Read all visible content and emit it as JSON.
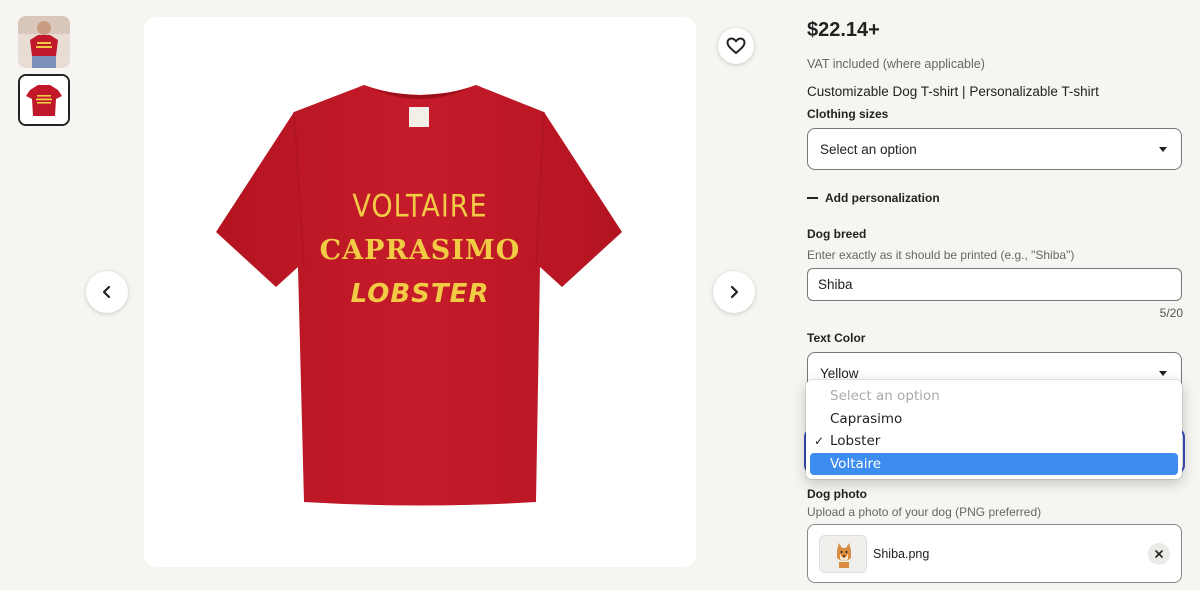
{
  "gallery": {
    "thumbnails": [
      "thumbnail-model-photo",
      "thumbnail-red-tshirt"
    ],
    "selected_index": 1,
    "shirt_color": "#c0182a",
    "print_color": "#f2cb45",
    "shirt_lines": [
      "VOLTAIRE",
      "CAPRASIMO",
      "LOBSTER"
    ]
  },
  "product": {
    "price": "$22.14+",
    "vat_note": "VAT included (where applicable)",
    "title": "Customizable Dog T-shirt | Personalizable T-shirt"
  },
  "sizes": {
    "label": "Clothing sizes",
    "value": "Select an option"
  },
  "personalization": {
    "toggle_label": "Add personalization"
  },
  "dog_breed": {
    "label": "Dog breed",
    "hint": "Enter exactly as it should be printed (e.g., \"Shiba\")",
    "value": "Shiba",
    "counter": "5/20"
  },
  "text_color": {
    "label": "Text Color",
    "value": "Yellow"
  },
  "font_dropdown": {
    "options": [
      {
        "label": "Select an option",
        "disabled": true
      },
      {
        "label": "Caprasimo"
      },
      {
        "label": "Lobster",
        "checked": true
      },
      {
        "label": "Voltaire",
        "highlighted": true
      }
    ],
    "check_mark": "✓"
  },
  "dog_photo": {
    "label": "Dog photo",
    "hint": "Upload a photo of your dog (PNG preferred)",
    "file_name": "Shiba.png"
  },
  "colors": {
    "background": "#f6f5f1",
    "focus_ring": "#3a4fb8",
    "dropdown_highlight": "#3d8cf0"
  }
}
